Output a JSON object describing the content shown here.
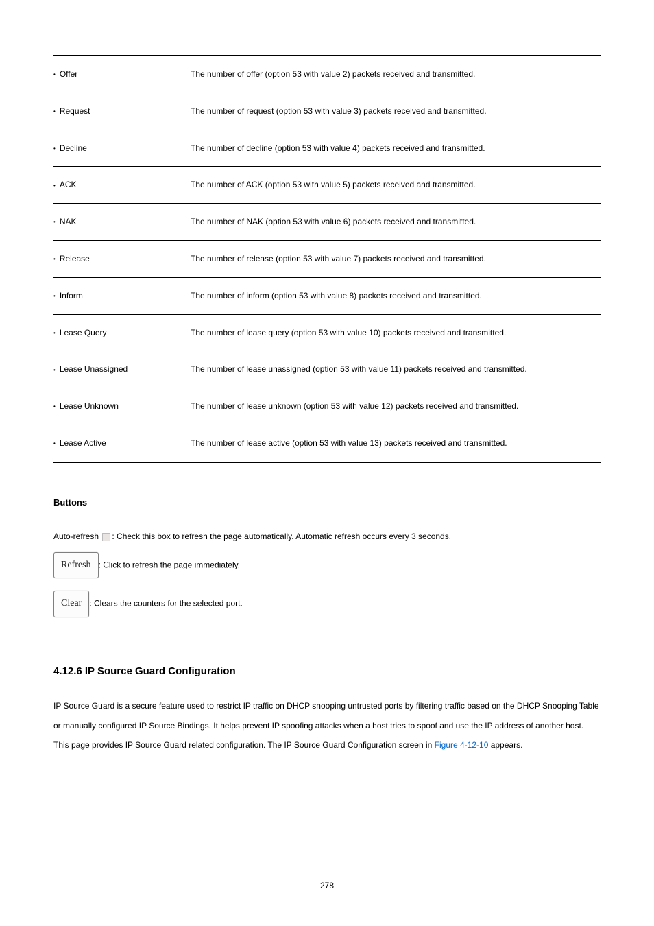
{
  "table": {
    "rows": [
      {
        "label": "Offer",
        "desc": "The number of offer (option 53 with value 2) packets received and transmitted."
      },
      {
        "label": "Request",
        "desc": "The number of request (option 53 with value 3) packets received and transmitted."
      },
      {
        "label": "Decline",
        "desc": "The number of decline (option 53 with value 4) packets received and transmitted."
      },
      {
        "label": "ACK",
        "desc": "The number of ACK (option 53 with value 5) packets received and transmitted."
      },
      {
        "label": "NAK",
        "desc": "The number of NAK (option 53 with value 6) packets received and transmitted."
      },
      {
        "label": "Release",
        "desc": "The number of release (option 53 with value 7) packets received and transmitted."
      },
      {
        "label": "Inform",
        "desc": "The number of inform (option 53 with value 8) packets received and transmitted."
      },
      {
        "label": "Lease Query",
        "desc": "The number of lease query (option 53 with value 10) packets received and transmitted."
      },
      {
        "label": "Lease Unassigned",
        "desc": "The number of lease unassigned (option 53 with value 11) packets received and transmitted."
      },
      {
        "label": "Lease Unknown",
        "desc": "The number of lease unknown (option 53 with value 12) packets received and transmitted."
      },
      {
        "label": "Lease Active",
        "desc": "The number of lease active (option 53 with value 13) packets received and transmitted."
      }
    ]
  },
  "buttons": {
    "heading": "Buttons",
    "auto_refresh_prefix": "Auto-refresh ",
    "auto_refresh_suffix": ": Check this box to refresh the page automatically. Automatic refresh occurs every 3 seconds.",
    "refresh_label": "Refresh",
    "refresh_desc": ": Click to refresh the page immediately.",
    "clear_label": "Clear",
    "clear_desc": ": Clears the counters for the selected port."
  },
  "section": {
    "heading": "4.12.6 IP Source Guard Configuration",
    "body_pre": "IP Source Guard is a secure feature used to restrict IP traffic on DHCP snooping untrusted ports by filtering traffic based on the DHCP Snooping Table or manually configured IP Source Bindings. It helps prevent IP spoofing attacks when a host tries to spoof and use the IP address of another host. This page provides IP Source Guard related configuration. The IP Source Guard Configuration screen in ",
    "figure_ref": "Figure 4-12-10",
    "body_post": " appears."
  },
  "page_number": "278"
}
